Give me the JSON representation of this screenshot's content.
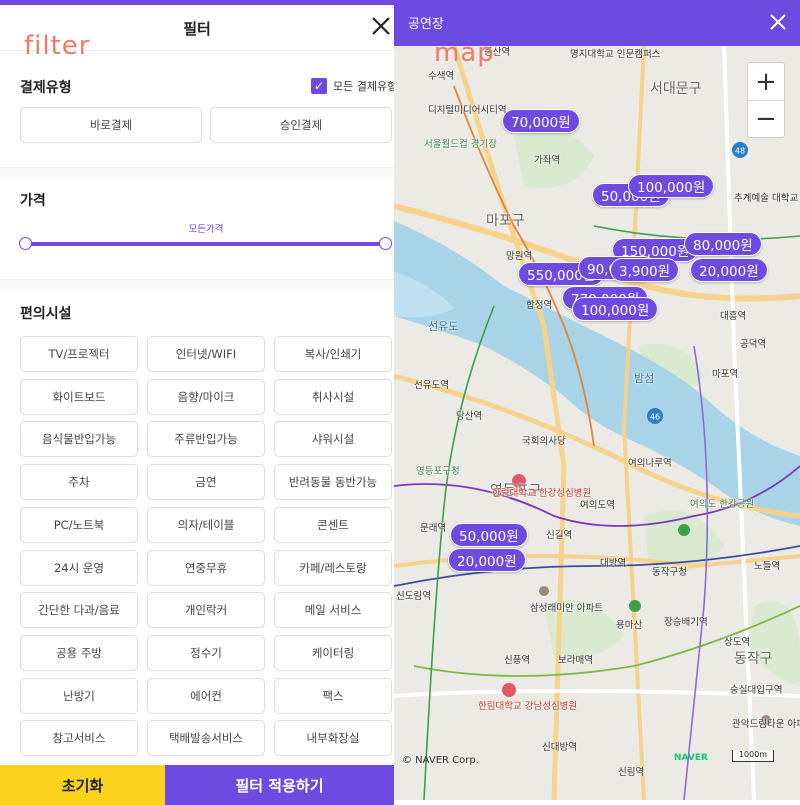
{
  "annotations": {
    "filter": "filter",
    "map": "map"
  },
  "filter": {
    "title": "필터",
    "payment": {
      "label": "결제유형",
      "all_label": "모든 결제유형",
      "options": [
        "바로결제",
        "승인결제"
      ]
    },
    "price": {
      "label": "가격",
      "range_label": "모든가격",
      "min_fraction": 0,
      "max_fraction": 1
    },
    "facilities": {
      "label": "편의시설",
      "options": [
        "TV/프로젝터",
        "인터넷/WIFI",
        "복사/인쇄기",
        "화이트보드",
        "음향/마이크",
        "취사시설",
        "음식물반입가능",
        "주류반입가능",
        "샤워시설",
        "주차",
        "금연",
        "반려동물 동반가능",
        "PC/노트북",
        "의자/테이블",
        "콘센트",
        "24시 운영",
        "연중무휴",
        "카페/레스토랑",
        "간단한 다과/음료",
        "개인락커",
        "메일 서비스",
        "공용 주방",
        "정수기",
        "케이터링",
        "난방기",
        "에어컨",
        "팩스",
        "창고서비스",
        "택배발송서비스",
        "내부화장실"
      ]
    },
    "reset_label": "초기화",
    "apply_label": "필터 적용하기"
  },
  "map": {
    "title": "공연장",
    "zoom_in": "+",
    "zoom_out": "−",
    "price_pins": [
      "70,000원",
      "50,000원",
      "100,000원",
      "150,000원",
      "80,000원",
      "550,000원",
      "90,000원",
      "3,900원",
      "20,000원",
      "770,000원",
      "100,000원",
      "50,000원",
      "20,000원"
    ],
    "place_labels": [
      "증산역",
      "수색역",
      "명지대학교 인문캠퍼스",
      "서대문구",
      "디지털미디어시티역",
      "가좌역",
      "서울월드컵 경기장",
      "마포구",
      "추계예술 대학교",
      "망원역",
      "합정역",
      "대흥역",
      "공덕역",
      "선유도",
      "선유도역",
      "밤섬",
      "마포역",
      "당산역",
      "국회의사당",
      "여의나루역",
      "영등포구청",
      "영등포구",
      "한림대학교 한강성심병원",
      "여의도역",
      "여의도 한강공원",
      "문래역",
      "신길역",
      "대방역",
      "노들역",
      "동작구청",
      "신도림역",
      "삼성래미안 아파트",
      "용마산",
      "장승배기역",
      "상도역",
      "동작구",
      "신풍역",
      "보라매역",
      "한림대학교 강남성심병원",
      "숭실대입구역",
      "관악드림타운 아파트",
      "신대방역",
      "신림역"
    ],
    "route_numbers": [
      "48",
      "46"
    ],
    "copyright": "© NAVER Corp.",
    "naver_badge": "NAVER",
    "scale": "1000m"
  },
  "colors": {
    "accent": "#6d4ae0",
    "reset": "#fcd31c",
    "annotation": "#f07a6a",
    "river": "#a9d4e8",
    "park": "#cfe6c3"
  }
}
